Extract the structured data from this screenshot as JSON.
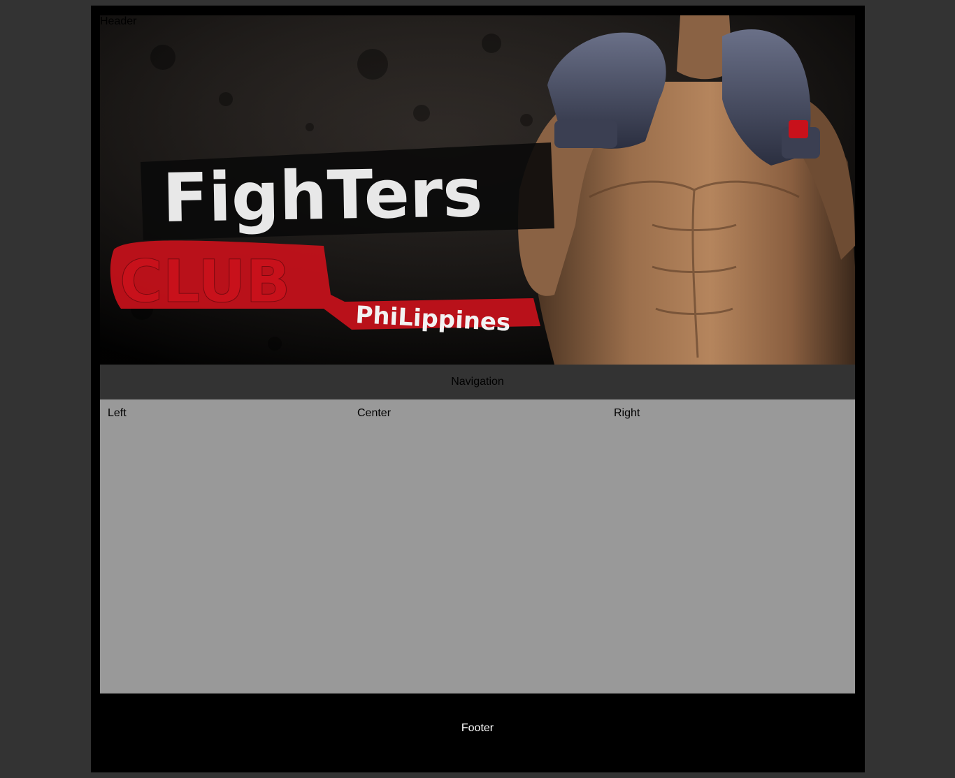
{
  "header": {
    "label": "Header",
    "banner_alt": "Fighters Club Philippines",
    "logo_line1": "FighTers",
    "logo_line2": "CLUB",
    "logo_line3": "PhiLippines",
    "accent_red": "#c8111b",
    "logo_white": "#e8e8e8"
  },
  "nav": {
    "label": "Navigation"
  },
  "content": {
    "left_label": "Left",
    "center_label": "Center",
    "right_label": "Right"
  },
  "footer": {
    "label": "Footer"
  }
}
